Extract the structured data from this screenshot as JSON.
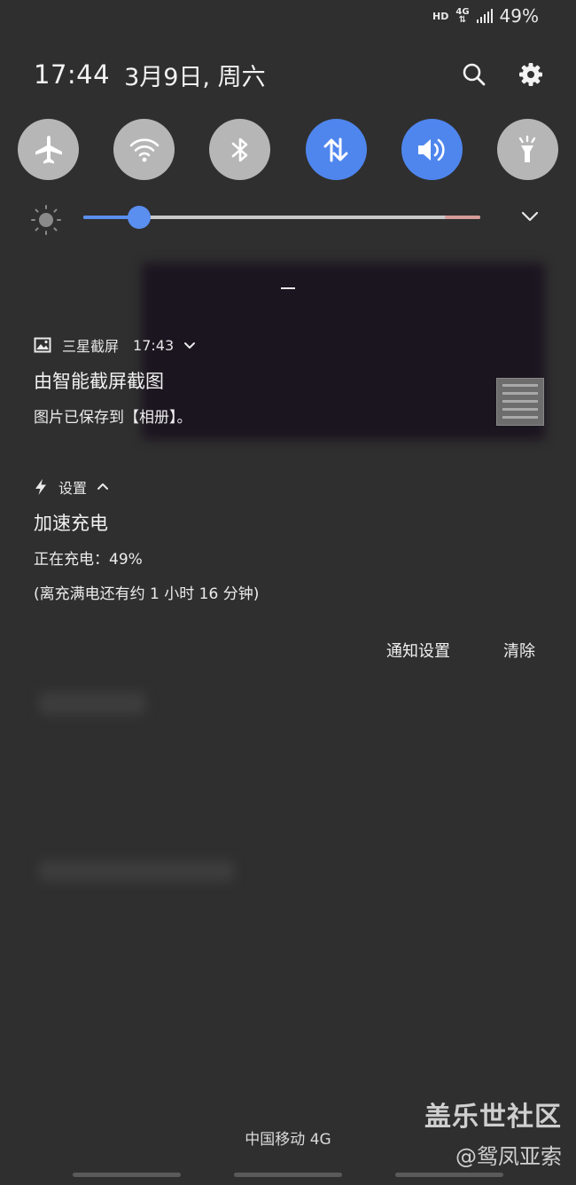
{
  "status_bar": {
    "hd": "HD",
    "network": "4G",
    "battery": "49%"
  },
  "header": {
    "time": "17:44",
    "date": "3月9日, 周六",
    "icons": [
      "search-icon",
      "gear-icon"
    ]
  },
  "quick_toggles": [
    {
      "name": "airplane",
      "icon": "airplane-icon",
      "state": "off"
    },
    {
      "name": "wifi",
      "icon": "wifi-icon",
      "state": "off"
    },
    {
      "name": "bluetooth",
      "icon": "bluetooth-icon",
      "state": "off"
    },
    {
      "name": "mobile-data",
      "icon": "data-arrows-icon",
      "state": "on"
    },
    {
      "name": "sound",
      "icon": "speaker-icon",
      "state": "on"
    },
    {
      "name": "flashlight",
      "icon": "flashlight-icon",
      "state": "off"
    }
  ],
  "brightness": {
    "level": 0.14
  },
  "notifications": [
    {
      "app_name": "三星截屏",
      "time": "17:43",
      "title": "由智能截屏截图",
      "body": "图片已保存到【相册】。"
    },
    {
      "app_name": "设置",
      "title": "加速充电",
      "body": "正在充电：49%",
      "body2": "(离充满电还有约 1 小时 16 分钟)"
    }
  ],
  "actions": {
    "settings_label": "通知设置",
    "clear_label": "清除"
  },
  "carrier": "中国移动 4G",
  "watermark": {
    "title": "盖乐世社区",
    "user": "@鸳凤亚索"
  },
  "colors": {
    "accent": "#4f86ee",
    "toggle_off": "#b6b6b6",
    "background": "#2f2f2f"
  }
}
